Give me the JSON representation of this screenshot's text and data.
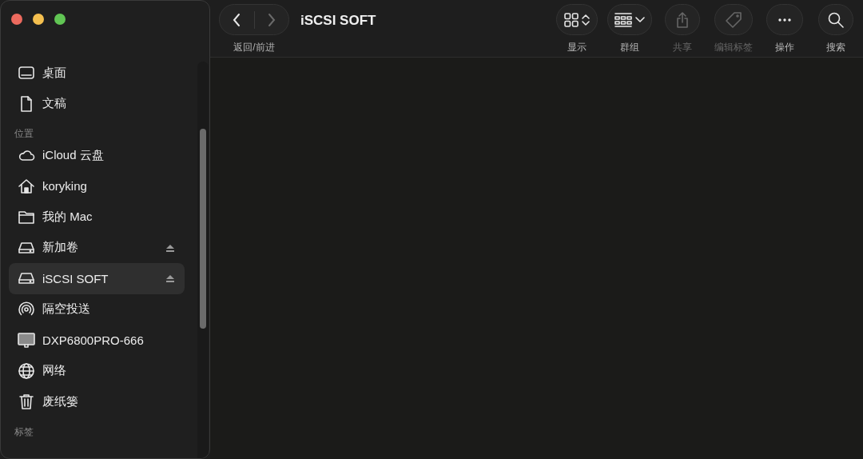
{
  "window": {
    "title": "iSCSI SOFT"
  },
  "navigation": {
    "label": "返回/前进",
    "back_disabled": false,
    "forward_disabled": true
  },
  "toolbar": [
    {
      "kind": "view",
      "label": "显示",
      "disabled": false
    },
    {
      "kind": "group",
      "label": "群组",
      "disabled": false
    },
    {
      "kind": "share",
      "label": "共享",
      "disabled": true
    },
    {
      "kind": "tag",
      "label": "编辑标签",
      "disabled": true
    },
    {
      "kind": "more",
      "label": "操作",
      "disabled": false
    },
    {
      "kind": "search",
      "label": "搜索",
      "disabled": false
    }
  ],
  "sidebar": {
    "sections": [
      {
        "items": [
          {
            "kind": "desktop",
            "label": "桌面",
            "selected": false,
            "ejectable": false
          },
          {
            "kind": "document",
            "label": "文稿",
            "selected": false,
            "ejectable": false
          }
        ]
      },
      {
        "title": "位置",
        "items": [
          {
            "kind": "cloud",
            "label": "iCloud 云盘",
            "selected": false,
            "ejectable": false
          },
          {
            "kind": "home",
            "label": "koryking",
            "selected": false,
            "ejectable": false
          },
          {
            "kind": "folder",
            "label": "我的 Mac",
            "selected": false,
            "ejectable": false
          },
          {
            "kind": "drive",
            "label": "新加卷",
            "selected": false,
            "ejectable": true
          },
          {
            "kind": "drive",
            "label": "iSCSI SOFT",
            "selected": true,
            "ejectable": true
          },
          {
            "kind": "airdrop",
            "label": "隔空投送",
            "selected": false,
            "ejectable": false
          },
          {
            "kind": "display",
            "label": "DXP6800PRO-666",
            "selected": false,
            "ejectable": false
          },
          {
            "kind": "globe",
            "label": "网络",
            "selected": false,
            "ejectable": false
          },
          {
            "kind": "trash",
            "label": "废纸篓",
            "selected": false,
            "ejectable": false
          }
        ]
      },
      {
        "title": "标签"
      }
    ]
  }
}
